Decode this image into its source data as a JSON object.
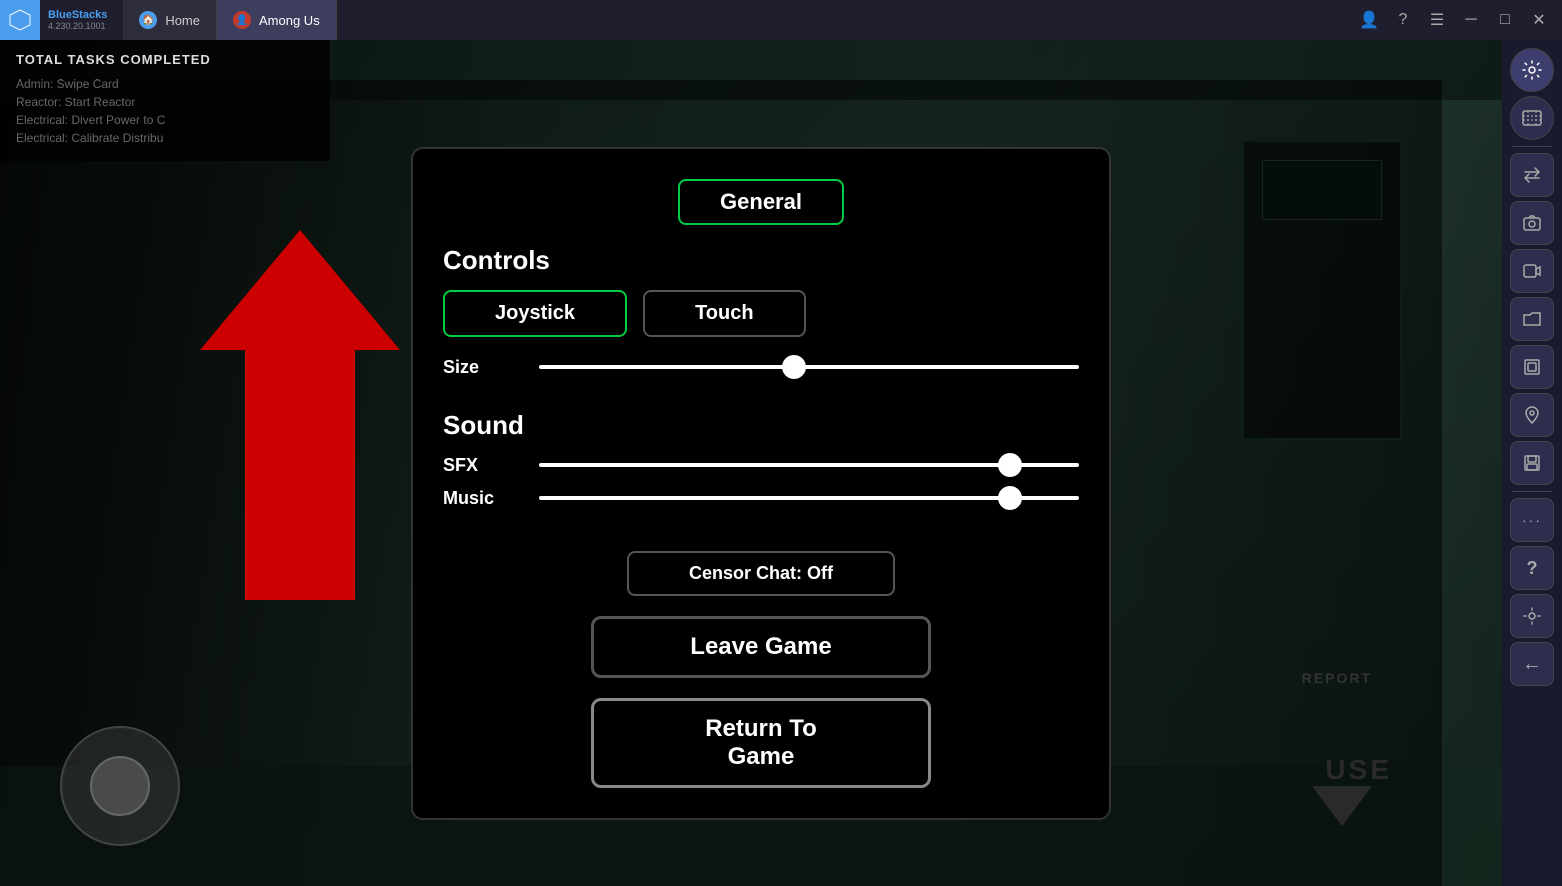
{
  "titlebar": {
    "logo_text": "BS",
    "app_name": "BlueStacks",
    "app_version": "4.230.20.1001",
    "tabs": [
      {
        "id": "home",
        "label": "Home",
        "icon_color": "#4a9eed",
        "active": false
      },
      {
        "id": "among-us",
        "label": "Among Us",
        "icon_color": "#c0392b",
        "active": true
      }
    ],
    "controls": [
      "user-icon",
      "help-icon",
      "menu-icon",
      "minimize-icon",
      "maximize-icon",
      "close-icon"
    ]
  },
  "task_panel": {
    "title": "TOTAL TASKS COMPLETED",
    "tasks": [
      "Admin: Swipe Card",
      "Reactor: Start Reactor",
      "Electrical: Divert Power to C",
      "Electrical: Calibrate Distribu"
    ]
  },
  "settings_modal": {
    "tab_label": "General",
    "controls_section": {
      "title": "Controls",
      "joystick_btn": "Joystick",
      "touch_btn": "Touch",
      "size_label": "Size",
      "size_slider_pct": 45
    },
    "sound_section": {
      "title": "Sound",
      "sfx_label": "SFX",
      "sfx_slider_pct": 85,
      "music_label": "Music",
      "music_slider_pct": 85
    },
    "censor_chat_label": "Censor Chat: Off",
    "leave_game_label": "Leave Game",
    "return_to_game_label": "Return To Game"
  },
  "right_sidebar": {
    "buttons": [
      {
        "name": "settings",
        "icon": "⚙"
      },
      {
        "name": "map",
        "icon": "🗺"
      },
      {
        "name": "transfer",
        "icon": "↔"
      },
      {
        "name": "screenshot",
        "icon": "📷"
      },
      {
        "name": "record",
        "icon": "▶"
      },
      {
        "name": "folder",
        "icon": "📁"
      },
      {
        "name": "layers",
        "icon": "⧉"
      },
      {
        "name": "location",
        "icon": "📍"
      },
      {
        "name": "save",
        "icon": "💾"
      },
      {
        "name": "more",
        "icon": "⋯"
      },
      {
        "name": "help",
        "icon": "?"
      },
      {
        "name": "settings2",
        "icon": "⚙"
      },
      {
        "name": "back",
        "icon": "←"
      }
    ]
  }
}
